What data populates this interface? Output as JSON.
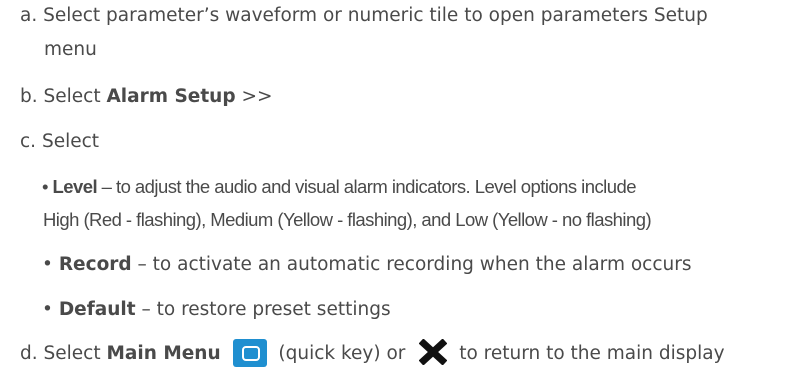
{
  "steps": {
    "a": {
      "marker": "a.",
      "text_1": "Select parameter’s waveform or numeric tile to open parameters Setup",
      "text_2": "menu"
    },
    "b": {
      "marker": "b.",
      "pre": "Select ",
      "bold": "Alarm Setup",
      "post": " >>"
    },
    "c": {
      "marker": "c.",
      "text": "Select",
      "bullets": [
        {
          "bullet": "•",
          "term": "Level",
          "desc": " – to adjust the audio and visual alarm indicators. Level options include",
          "continuation": "High (Red - flashing), Medium (Yellow - flashing), and Low (Yellow - no flashing)"
        },
        {
          "bullet": "•",
          "term": "Record",
          "desc": " – to activate an automatic recording when the alarm occurs"
        },
        {
          "bullet": "•",
          "term": "Default",
          "desc": " – to restore preset settings"
        }
      ]
    },
    "d": {
      "marker": "d.",
      "pre": "Select ",
      "bold": "Main Menu",
      "mid": "(quick key) or",
      "post": "to return to the main display",
      "icons": [
        "main-menu-key-icon",
        "close-x-icon"
      ],
      "icon_color": "#1f8fd0"
    }
  },
  "colors": {
    "text": "#4a4a4a",
    "accent": "#1f8fd0"
  }
}
